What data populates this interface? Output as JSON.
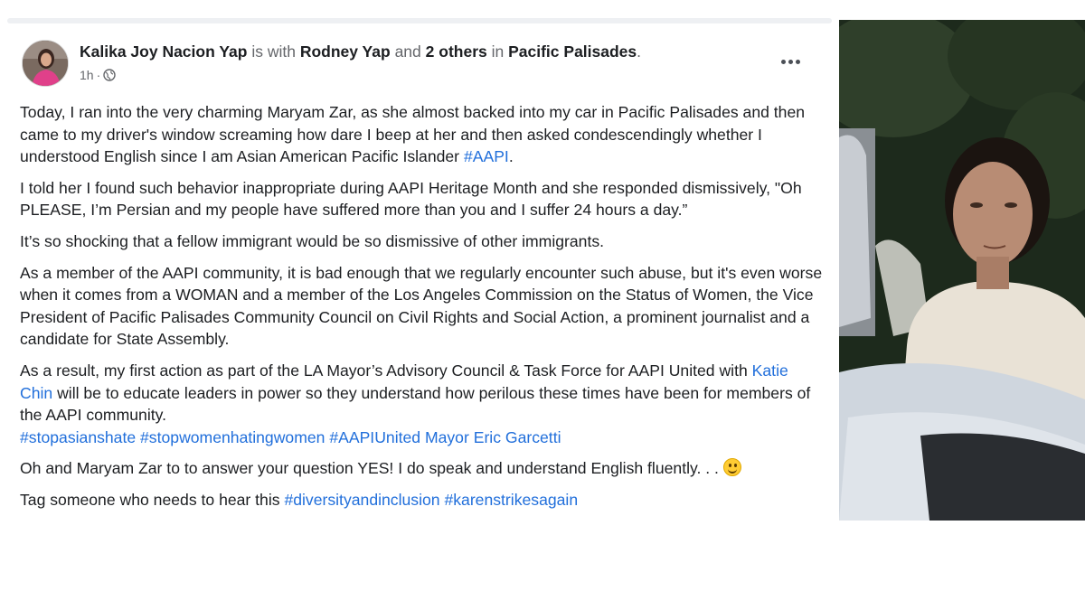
{
  "post": {
    "author": "Kalika Joy Nacion Yap",
    "with_text": "is with",
    "tagged_person": "Rodney Yap",
    "and_text": "and",
    "others": "2 others",
    "in_text": "in",
    "location": "Pacific Palisades",
    "period": ".",
    "time": "1h",
    "separator": "·",
    "privacy_icon": "globe-icon",
    "more_icon": "more-options-icon",
    "paragraphs": {
      "p1_text": "Today, I ran into the very charming Maryam Zar, as she almost backed into my car in Pacific Palisades and then came to my driver's window screaming how dare I beep at her and then asked condescendingly whether I  understood English since I am Asian American Pacific Islander ",
      "p1_tag": "#AAPI",
      "p1_end": ".",
      "p2": "I told her I found such behavior inappropriate during AAPI Heritage Month and she responded dismissively, \"Oh PLEASE, I’m Persian and my people have suffered more than you and I suffer 24 hours a day.”",
      "p3": "It’s so shocking that a fellow immigrant would be so dismissive of other immigrants.",
      "p4": "As a member of the AAPI community, it is bad enough that we regularly encounter such abuse, but it's even worse when it comes from a WOMAN and a member of the Los Angeles Commission on the Status of Women, the Vice President of Pacific Palisades Community Council on Civil Rights and Social Action, a prominent journalist and a candidate for State Assembly.",
      "p5_start": "As a result, my first action as part of the LA Mayor’s Advisory Council & Task Force for AAPI United with ",
      "p5_mention": "Katie Chin",
      "p5_end": " will be to educate leaders in power so they understand how perilous these times have been for members of the AAPI community.",
      "p5_tags": "#stopasianshate #stopwomenhatingwomen #AAPIUnited Mayor Eric Garcetti",
      "p6": "Oh and Maryam Zar to to answer your question YES! I do speak and understand English fluently. . . ",
      "p6_emoji": "smiling-face-emoji",
      "p7_start": "Tag someone who needs to hear this ",
      "p7_tags": "#diversityandinclusion #karenstrikesagain"
    }
  },
  "photo": {
    "description_icon": "woman-photo"
  },
  "colors": {
    "link": "#216fdb",
    "text": "#1c1e21",
    "secondary": "#65676b"
  }
}
